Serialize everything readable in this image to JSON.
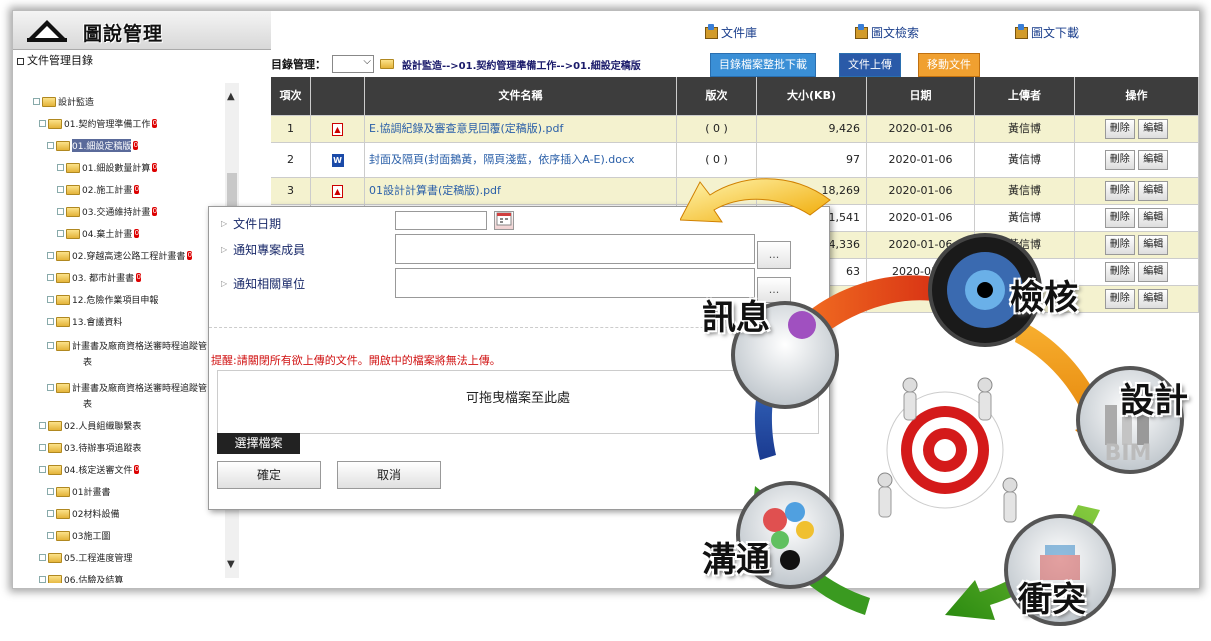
{
  "header": {
    "title": "圖說管理",
    "links": [
      {
        "label": "文件庫",
        "icon": "box-icon"
      },
      {
        "label": "圖文檢索",
        "icon": "box-icon"
      },
      {
        "label": "圖文下載",
        "icon": "box-icon"
      }
    ]
  },
  "sidebar": {
    "heading": "文件管理目錄",
    "items": [
      {
        "label": "設計監造",
        "badge": ""
      },
      {
        "label": "01.契約管理準備工作",
        "badge": "0"
      },
      {
        "label": "01.細設定稿版",
        "badge": "0"
      },
      {
        "label": "01.細設數量計算",
        "badge": "0"
      },
      {
        "label": "02.施工計畫",
        "badge": "0"
      },
      {
        "label": "03.交通維持計畫",
        "badge": "0"
      },
      {
        "label": "04.棄土計畫",
        "badge": "0"
      },
      {
        "label": "02.穿越高速公路工程計畫書",
        "badge": "0"
      },
      {
        "label": "03.          都市計畫書",
        "badge": "0"
      },
      {
        "label": "12.危險作業項目申報",
        "badge": ""
      },
      {
        "label": "13.會議資料",
        "badge": ""
      },
      {
        "label": "計畫書及廠商資格送審時程追蹤管",
        "badge": ""
      },
      {
        "label": "表",
        "badge": ""
      },
      {
        "label": "計畫書及廠商資格送審時程追蹤管",
        "badge": ""
      },
      {
        "label": "表",
        "badge": ""
      },
      {
        "label": "02.人員組織聯繫表",
        "badge": ""
      },
      {
        "label": "03.待辦事項追蹤表",
        "badge": ""
      },
      {
        "label": "04.核定送審文件",
        "badge": "0"
      },
      {
        "label": "01計畫書",
        "badge": ""
      },
      {
        "label": "02材料設備",
        "badge": ""
      },
      {
        "label": "03施工圖",
        "badge": ""
      },
      {
        "label": "05.工程進度管理",
        "badge": ""
      },
      {
        "label": "06.估驗及結算",
        "badge": ""
      }
    ]
  },
  "crumb": {
    "label": "目錄管理：",
    "path": "設計監造-->01.契約管理準備工作-->01.細設定稿版",
    "btn_download": "目錄檔案整批下載",
    "btn_upload": "文件上傳",
    "btn_move": "移動文件"
  },
  "table": {
    "headers": [
      "項次",
      "",
      "文件名稱",
      "版次",
      "大小(KB)",
      "日期",
      "上傳者",
      "操作"
    ],
    "rows": [
      {
        "no": "1",
        "type": "pdf",
        "name": "E.協調紀錄及審查意見回覆(定稿版).pdf",
        "ver": "( 0 )",
        "size": "9,426",
        "date": "2020-01-06",
        "uploader": "黃信博"
      },
      {
        "no": "2",
        "type": "doc",
        "name": "封面及隔頁(封面鵝黃，隔頁淺藍，依序插入A-E).docx",
        "ver": "( 0 )",
        "size": "97",
        "date": "2020-01-06",
        "uploader": "黃信博"
      },
      {
        "no": "3",
        "type": "pdf",
        "name": "01設計計算書(定稿版).pdf",
        "ver": "",
        "size": "18,269",
        "date": "2020-01-06",
        "uploader": "黃信博"
      },
      {
        "no": "",
        "type": "",
        "name": "",
        "ver": "",
        "size": "1,541",
        "date": "2020-01-06",
        "uploader": "黃信博"
      },
      {
        "no": "",
        "type": "",
        "name": "",
        "ver": "",
        "size": "44,336",
        "date": "2020-01-06",
        "uploader": "黃信博"
      },
      {
        "no": "",
        "type": "",
        "name": "",
        "ver": "",
        "size": "63",
        "date": "2020-01-0",
        "uploader": ""
      },
      {
        "no": "",
        "type": "",
        "name": "",
        "ver": "",
        "size": "",
        "date": "",
        "uploader": ""
      }
    ],
    "delete_label": "刪除",
    "edit_label": "編輯"
  },
  "dialog": {
    "field_date": "文件日期",
    "field_members": "通知專案成員",
    "field_units": "通知相關單位",
    "more_label": "...",
    "warning": "提醒:請關閉所有欲上傳的文件。開啟中的檔案將無法上傳。",
    "drop_hint": "可拖曳檔案至此處",
    "choose_label": "選擇檔案",
    "ok_label": "確定",
    "cancel_label": "取消"
  },
  "cycle": {
    "labels": [
      "訊息",
      "檢核",
      "設計",
      "衝突",
      "溝通"
    ],
    "colors": {
      "red": "#e03010",
      "orange": "#f08a10",
      "yellow": "#f5c21a",
      "green": "#4aa31c",
      "blue": "#1a5ab0",
      "purple": "#6a2a90"
    }
  }
}
